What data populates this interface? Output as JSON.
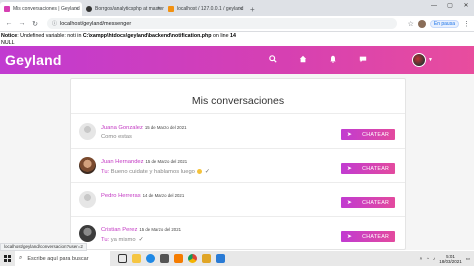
{
  "browser": {
    "tabs": [
      {
        "label": "Mis conversaciones | Geyland",
        "fav_color": "#d640b2",
        "active": true
      },
      {
        "label": "Borrgos/analyticsphp at master",
        "fav_color": "#333333",
        "active": false
      },
      {
        "label": "localhost / 127.0.0.1 / geyland",
        "fav_color": "#f29111",
        "active": false
      }
    ],
    "new_tab": "+",
    "address": "localhost/geyland/messenger",
    "paused_label": "En pausa"
  },
  "notice": {
    "label": "Notice",
    "text_before": ": Undefined variable: noti in ",
    "path": "C:\\xampp\\htdocs\\geyland\\backend\\notification.php",
    "text_line": " on line ",
    "line": "14",
    "null_text": "NULL"
  },
  "app": {
    "brand": "Geyland",
    "icons": [
      "search-icon",
      "home-icon",
      "notification-icon",
      "messages-icon",
      "user-avatar"
    ]
  },
  "messenger": {
    "title": "Mis conversaciones",
    "button_label": "CHATEAR",
    "conversations": [
      {
        "name": "Juana Gonzalez",
        "date": "15 de Marzo del 2021",
        "you": "",
        "message": "Como estas",
        "avatar": "default"
      },
      {
        "name": "Juan Hernandez",
        "date": "15 de Marzo del 2021",
        "you": "Tu:",
        "message": " Bueno cuidate y hablamos luego",
        "avatar": "photo"
      },
      {
        "name": "Pedro Herreras",
        "date": "14 de Marzo del 2021",
        "you": "",
        "message": "",
        "avatar": "default"
      },
      {
        "name": "Cristian Perez",
        "date": "15 de Marzo del 2021",
        "you": "Tu:",
        "message": " ya mismo",
        "avatar": "photo"
      }
    ]
  },
  "status_url": "localhost/geyland/conversacion?user=2",
  "taskbar": {
    "search_placeholder": "Escribe aquí para buscar",
    "time": "5:01",
    "date": "18/03/2021"
  }
}
